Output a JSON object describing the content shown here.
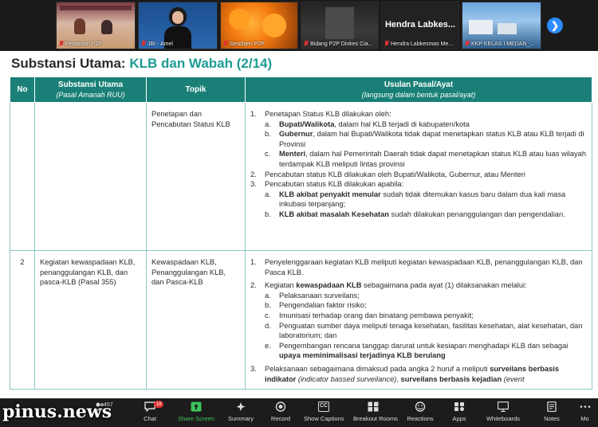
{
  "video_tiles": [
    {
      "name": "Peraturan P2P",
      "muted": true
    },
    {
      "name": "JBI - Amel",
      "muted": true
    },
    {
      "name": "Sesditjen P2P",
      "muted": true
    },
    {
      "name": "Bidang P2P Dinkes Cia...",
      "muted": true
    },
    {
      "name": "Hendra Labkesmas Me...",
      "muted": true,
      "big_name": "Hendra Labkes..."
    },
    {
      "name": "KKP KELAS I MEDAN_...",
      "muted": true
    }
  ],
  "slide": {
    "title_prefix": "Substansi Utama: ",
    "title_accent": "KLB dan Wabah (2/14)",
    "headers": {
      "no": "No",
      "substansi": "Substansi Utama",
      "substansi_sub": "(Pasal Amanah RUU)",
      "topik": "Topik",
      "usulan": "Usulan Pasal/Ayat",
      "usulan_sub": "(langsung dalam bentuk pasal/ayat)"
    },
    "row1": {
      "no": "",
      "substansi": "",
      "topik": "Penetapan dan Pencabutan Status KLB",
      "item1_num": "1.",
      "item1_text": "Penetapan Status KLB dilakukan oleh:",
      "item1a_let": "a.",
      "item1a_bold": "Bupati/Walikota",
      "item1a_rest": ", dalam hal KLB terjadi di kabupaten/kota",
      "item1b_let": "b.",
      "item1b_bold": "Gubernur",
      "item1b_rest": ", dalam hal Bupati/Walikota tidak dapat menetapkan status KLB atau KLB terjadi di Provinsi",
      "item1c_let": "c.",
      "item1c_bold": "Menteri",
      "item1c_rest": ", dalam hal Pemerintah Daerah tidak dapat menetapkan status KLB atau luas wilayah terdampak KLB meliputi lintas provinsi",
      "item2_num": "2.",
      "item2_text": "Pencabutan status KLB dilakukan oleh Bupati/Walikota, Gubernur, atau Menteri",
      "item3_num": "3.",
      "item3_text": "Pencabutan status KLB dilakukan apabila:",
      "item3a_let": "a.",
      "item3a_bold": "KLB akibat penyakit menular",
      "item3a_rest": " sudah tidak ditemukan kasus baru dalam dua kali masa inkubasi terpanjang;",
      "item3b_let": "b.",
      "item3b_bold": "KLB akibat masalah Kesehatan",
      "item3b_rest": " sudah dilakukan penanggulangan dan pengendalian."
    },
    "row2": {
      "no": "2",
      "substansi": "Kegiatan kewaspadaan KLB, penanggulangan KLB, dan pasca-KLB (Pasal 355)",
      "topik": "Kewaspadaan KLB, Penanggulangan KLB, dan Pasca-KLB",
      "item1_num": "1.",
      "item1_text": "Penyelenggaraan kegiatan KLB meliputi kegiatan kewaspadaan KLB, penanggulangan KLB, dan Pasca KLB.",
      "item2_num": "2.",
      "item2_pre": "Kegiatan ",
      "item2_bold": "kewaspadaan KLB",
      "item2_rest": " sebagaimana pada ayat (1) dilaksanakan melalui:",
      "item2a_let": "a.",
      "item2a_text": "Pelaksanaan surveilans;",
      "item2b_let": "b.",
      "item2b_text": "Pengendalian faktor risiko;",
      "item2c_let": "c.",
      "item2c_text": "Imunisasi terhadap orang dan binatang pembawa penyakit;",
      "item2d_let": "d.",
      "item2d_text": "Penguatan sumber daya meliputi tenaga kesehatan, fasilitas kesehatan, alat kesehatan, dan laboratorium; dan",
      "item2e_let": "e.",
      "item2e_text": "Pengembangan rencana tanggap darurat untuk kesiapan menghadapi KLB dan sebagai ",
      "item2e_bold": "upaya meminimalisasi terjadinya KLB berulang",
      "item3_num": "3.",
      "item3_pre": "Pelaksanaan sebagaimana dimaksud pada angka 2 huruf a meliputi ",
      "item3_bold1": "surveilans berbasis indikator",
      "item3_ital1": " (indicator bassed surveilance)",
      "item3_mid": ", ",
      "item3_bold2": "surveilans berbasis kejadian",
      "item3_ital2": " (event"
    }
  },
  "toolbar": {
    "participants_count": "457",
    "chat_badge": "18",
    "items": {
      "chat": "Chat",
      "share": "Share Screen",
      "summary": "Summary",
      "record": "Record",
      "captions": "Show Captions",
      "breakout": "Breakout Rooms",
      "reactions": "Reactions",
      "apps": "Apps",
      "whiteboards": "Whiteboards",
      "notes": "Notes",
      "more": "Mo"
    },
    "captions_icon_text": "CC"
  },
  "watermark": "pinus.news",
  "colors": {
    "header_teal": "#1a8077",
    "title_accent": "#1e9c94",
    "share_green": "#3cc55a",
    "badge_red": "#e02f2f",
    "zoom_blue": "#2d8cff"
  }
}
